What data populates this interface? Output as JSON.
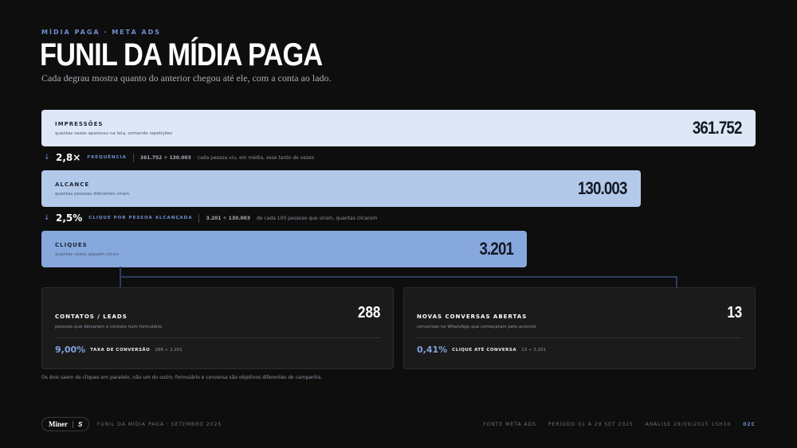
{
  "header": {
    "eyebrow": "MÍDIA PAGA · META ADS",
    "title": "FUNIL DA MÍDIA PAGA",
    "subtitle": "Cada degrau mostra quanto do anterior chegou até ele, com a conta ao lado."
  },
  "funnel": [
    {
      "label": "IMPRESSÕES",
      "desc": "quantas vezes apareceu na tela, somando repetições",
      "value": "361.752",
      "color": "#dde7f6"
    },
    {
      "label": "ALCANCE",
      "desc": "quantas pessoas diferentes viram",
      "value": "130.003",
      "color": "#b3c9e9"
    },
    {
      "label": "CLIQUES",
      "desc": "quantas vezes alguém clicou",
      "value": "3.201",
      "color": "#87a8dc"
    }
  ],
  "ratios": [
    {
      "arrow": "↓",
      "value": "2,8×",
      "tag": "FREQUÊNCIA",
      "calc": "361.752 ÷ 130.003",
      "explain": "cada pessoa viu, em média, esse tanto de vezes"
    },
    {
      "arrow": "↓",
      "value": "2,5%",
      "tag": "CLIQUE POR PESSOA ALCANÇADA",
      "calc": "3.201 ÷ 130.003",
      "explain": "de cada 100 pessoas que viram, quantas clicaram"
    }
  ],
  "cards": [
    {
      "title": "CONTATOS / LEADS",
      "desc": "pessoas que deixaram o contato num formulário",
      "value": "288",
      "pct": "9,00%",
      "tag": "TAXA DE CONVERSÃO",
      "formula": "288 ÷ 3.201"
    },
    {
      "title": "NOVAS CONVERSAS ABERTAS",
      "desc": "conversas no WhatsApp que começaram pelo anúncio",
      "value": "13",
      "pct": "0,41%",
      "tag": "CLIQUE ATÉ CONVERSA",
      "formula": "13 ÷ 3.201"
    }
  ],
  "note": "Os dois saem de cliques em paralelo, não um do outro: formulário e conversa são objetivos diferentes de campanha.",
  "footer": {
    "logo_text": "Miner",
    "logo_badge": "S",
    "left": "FUNIL DA MÍDIA PAGA · SETEMBRO 2025",
    "source": "FONTE META ADS",
    "period": "PERÍODO 01 A 29 SET 2025",
    "analysis": "ANÁLISE 29/09/2025 15H30",
    "code": "02C",
    "separator": "·"
  },
  "colors": {
    "accent": "#6f8fd0",
    "background": "#0e0e0e",
    "card": "#1b1b1b"
  }
}
